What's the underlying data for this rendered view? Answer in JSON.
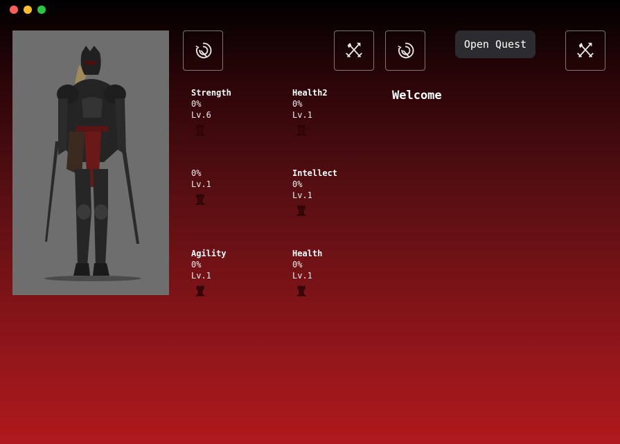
{
  "window": {
    "controls": [
      "close",
      "minimize",
      "maximize"
    ]
  },
  "portrait": {
    "icon": "armored-warrior-portrait"
  },
  "toolbar": {
    "buttons": [
      {
        "icon": "swirl-icon"
      },
      {
        "icon": "crossed-weapons-icon"
      },
      {
        "icon": "swirl-icon"
      },
      {
        "icon": "crossed-weapons-icon"
      }
    ],
    "quest_label": "Open Quest"
  },
  "welcome": "Welcome",
  "stats": [
    {
      "name": "Strength",
      "percent": "0%",
      "level": "Lv.6",
      "upgrade_icon": "tower-icon"
    },
    {
      "name": "Health2",
      "percent": "0%",
      "level": "Lv.1",
      "upgrade_icon": "tower-icon"
    },
    {
      "name": "",
      "percent": "0%",
      "level": "Lv.1",
      "upgrade_icon": "tower-icon"
    },
    {
      "name": "Intellect",
      "percent": "0%",
      "level": "Lv.1",
      "upgrade_icon": "tower-icon"
    },
    {
      "name": "Agility",
      "percent": "0%",
      "level": "Lv.1",
      "upgrade_icon": "tower-icon"
    },
    {
      "name": "Health",
      "percent": "0%",
      "level": "Lv.1",
      "upgrade_icon": "tower-icon"
    }
  ],
  "colors": {
    "background_top": "#000000",
    "background_bottom": "#b0191d",
    "quest_button": "#2c2c30",
    "portrait_bg": "#6e6e6e"
  }
}
